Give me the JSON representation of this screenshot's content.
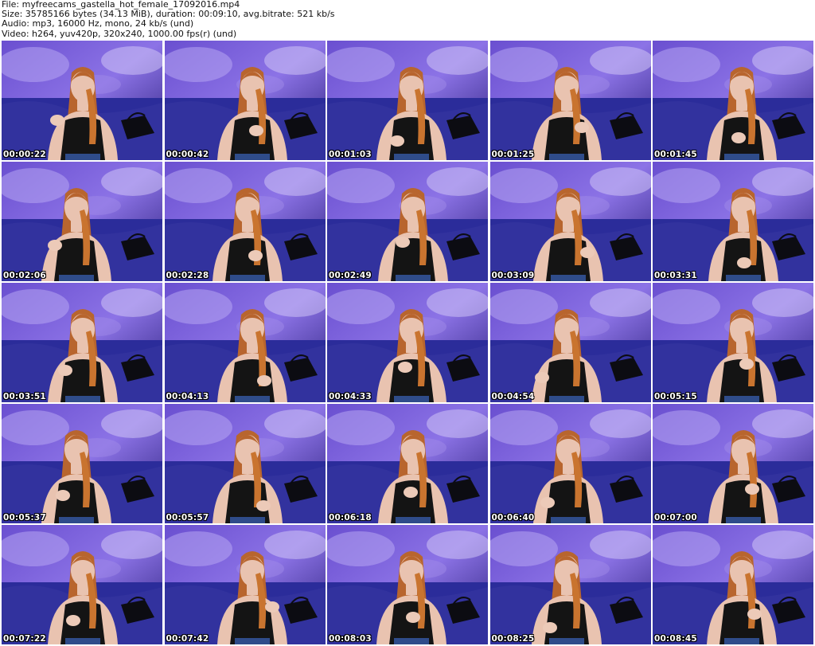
{
  "header": {
    "file_line": "File: myfreecams_gastella_hot_female_17092016.mp4",
    "size_line": "Size: 35785166 bytes (34.13 MiB), duration: 00:09:10, avg.bitrate: 521 kb/s",
    "audio_line": "Audio: mp3, 16000 Hz, mono, 24 kb/s (und)",
    "video_line": "Video: h264, yuv420p, 320x240, 1000.00 fps(r) (und)"
  },
  "colors": {
    "backdrop_purple": "#6a4fd0",
    "backdrop_dark": "#2a1f7a",
    "couch_blue": "#2b2c9a",
    "skin": "#e9c3b0",
    "hair": "#b8652e",
    "top_black": "#141414",
    "timestamp_text": "#ffffff"
  },
  "thumbnails": [
    {
      "timestamp": "00:00:22"
    },
    {
      "timestamp": "00:00:42"
    },
    {
      "timestamp": "00:01:03"
    },
    {
      "timestamp": "00:01:25"
    },
    {
      "timestamp": "00:01:45"
    },
    {
      "timestamp": "00:02:06"
    },
    {
      "timestamp": "00:02:28"
    },
    {
      "timestamp": "00:02:49"
    },
    {
      "timestamp": "00:03:09"
    },
    {
      "timestamp": "00:03:31"
    },
    {
      "timestamp": "00:03:51"
    },
    {
      "timestamp": "00:04:13"
    },
    {
      "timestamp": "00:04:33"
    },
    {
      "timestamp": "00:04:54"
    },
    {
      "timestamp": "00:05:15"
    },
    {
      "timestamp": "00:05:37"
    },
    {
      "timestamp": "00:05:57"
    },
    {
      "timestamp": "00:06:18"
    },
    {
      "timestamp": "00:06:40"
    },
    {
      "timestamp": "00:07:00"
    },
    {
      "timestamp": "00:07:22"
    },
    {
      "timestamp": "00:07:42"
    },
    {
      "timestamp": "00:08:03"
    },
    {
      "timestamp": "00:08:25"
    },
    {
      "timestamp": "00:08:45"
    }
  ]
}
